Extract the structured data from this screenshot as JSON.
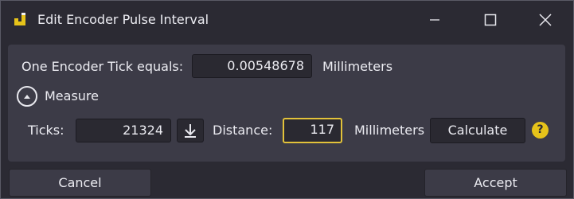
{
  "window": {
    "title": "Edit Encoder Pulse Interval",
    "controls": [
      "minimize-icon",
      "maximize-icon",
      "close-icon"
    ]
  },
  "encoder": {
    "tick_label": "One Encoder Tick equals:",
    "tick_value": "0.00548678",
    "tick_unit": "Millimeters"
  },
  "measure": {
    "toggle_label": "Measure",
    "ticks_label": "Ticks:",
    "ticks_value": "21324",
    "distance_label": "Distance:",
    "distance_value": "117",
    "distance_unit": "Millimeters",
    "calculate_label": "Calculate",
    "help_symbol": "?"
  },
  "footer": {
    "cancel_label": "Cancel",
    "accept_label": "Accept"
  },
  "colors": {
    "accent": "#e6c31a",
    "background": "#2b2a33",
    "panel": "#3c3b47",
    "field": "#2a2931"
  }
}
